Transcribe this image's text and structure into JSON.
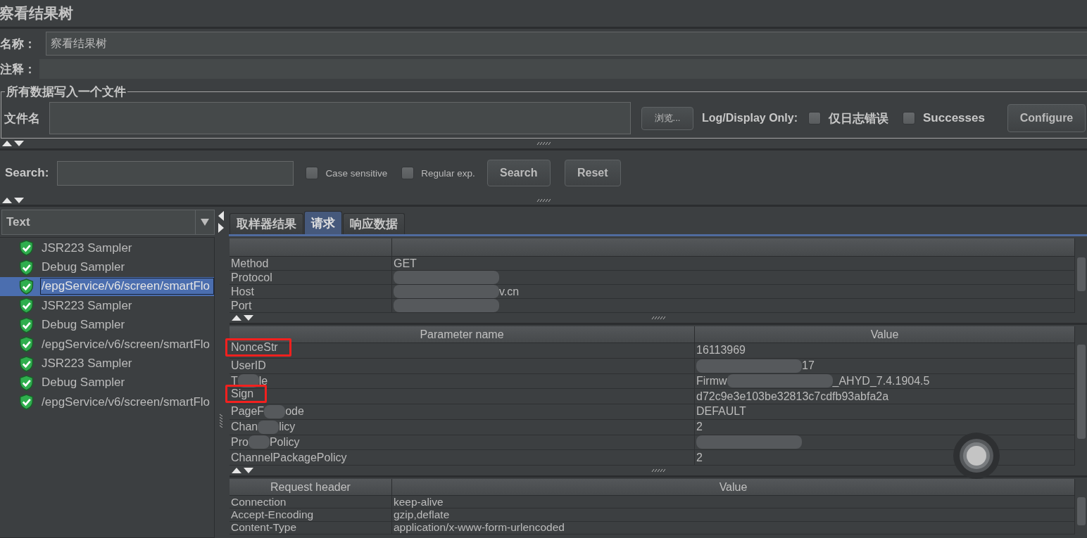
{
  "window": {
    "title": "察看结果树"
  },
  "name_field": {
    "label": "名称：",
    "value": "察看结果树"
  },
  "comment_field": {
    "label": "注释："
  },
  "file_output": {
    "title": "所有数据写入一个文件",
    "filename_label": "文件名",
    "browse_button": "浏览...",
    "log_display_label": "Log/Display Only:",
    "options": [
      {
        "label": "仅日志错误",
        "checked": false
      },
      {
        "label": "Successes",
        "checked": false
      }
    ],
    "configure_button": "Configure"
  },
  "search": {
    "label": "Search:",
    "options": [
      {
        "label": "Case sensitive",
        "checked": false
      },
      {
        "label": "Regular exp.",
        "checked": false
      }
    ],
    "search_button": "Search",
    "reset_button": "Reset"
  },
  "results_tree": {
    "renderer": "Text",
    "items": [
      {
        "label": "JSR223 Sampler",
        "passed": true,
        "selected": false
      },
      {
        "label": "Debug Sampler",
        "passed": true,
        "selected": false
      },
      {
        "label": "/epgService/v6/screen/smartFlo",
        "passed": true,
        "selected": true
      },
      {
        "label": "JSR223 Sampler",
        "passed": true,
        "selected": false
      },
      {
        "label": "Debug Sampler",
        "passed": true,
        "selected": false
      },
      {
        "label": "/epgService/v6/screen/smartFlo",
        "passed": true,
        "selected": false
      },
      {
        "label": "JSR223 Sampler",
        "passed": true,
        "selected": false
      },
      {
        "label": "Debug Sampler",
        "passed": true,
        "selected": false
      },
      {
        "label": "/epgService/v6/screen/smartFlo",
        "passed": true,
        "selected": false
      }
    ]
  },
  "tabs": [
    {
      "label": "取样器结果",
      "selected": false
    },
    {
      "label": "请求",
      "selected": true
    },
    {
      "label": "响应数据",
      "selected": false
    }
  ],
  "request_table": {
    "rows": [
      {
        "name": "Method",
        "value": "GET"
      },
      {
        "name": "Protocol",
        "value": [
          {
            "kind": "blur"
          }
        ]
      },
      {
        "name": "Host",
        "value": [
          {
            "kind": "blur"
          },
          {
            "kind": "text",
            "text": "v.cn"
          }
        ]
      },
      {
        "name": "Port",
        "value": [
          {
            "kind": "blur"
          }
        ]
      }
    ]
  },
  "parameters_table": {
    "columns": [
      "Parameter name",
      "Value"
    ],
    "rows": [
      {
        "name": "NonceStr",
        "value": "16113969",
        "highlighted": true
      },
      {
        "name": "UserID",
        "value": [
          {
            "kind": "blur"
          },
          {
            "kind": "text",
            "text": "17"
          }
        ],
        "highlighted": false
      },
      {
        "name": [
          {
            "kind": "text",
            "text": "T"
          },
          {
            "kind": "blur"
          },
          {
            "kind": "text",
            "text": "le"
          }
        ],
        "value": [
          {
            "kind": "text",
            "text": "Firmw"
          },
          {
            "kind": "blur"
          },
          {
            "kind": "text",
            "text": "_AHYD_7.4.1904.5"
          }
        ],
        "highlighted": false
      },
      {
        "name": "Sign",
        "value": "d72c9e3e103be32813c7cdfb93abfa2a",
        "highlighted": true
      },
      {
        "name": [
          {
            "kind": "text",
            "text": "PageF"
          },
          {
            "kind": "blur"
          },
          {
            "kind": "text",
            "text": "ode"
          }
        ],
        "value": "DEFAULT",
        "highlighted": false
      },
      {
        "name": [
          {
            "kind": "text",
            "text": "Chan"
          },
          {
            "kind": "blur"
          },
          {
            "kind": "text",
            "text": "licy"
          }
        ],
        "value": "2",
        "highlighted": false
      },
      {
        "name": [
          {
            "kind": "text",
            "text": "Pro"
          },
          {
            "kind": "blur"
          },
          {
            "kind": "text",
            "text": "Policy"
          }
        ],
        "value": [
          {
            "kind": "blur"
          }
        ],
        "highlighted": false
      },
      {
        "name": "ChannelPackagePolicy",
        "value": "2",
        "highlighted": false
      }
    ]
  },
  "headers_table": {
    "columns": [
      "Request header",
      "Value"
    ],
    "rows": [
      {
        "name": "Connection",
        "value": "keep-alive"
      },
      {
        "name": "Accept-Encoding",
        "value": "gzip,deflate"
      },
      {
        "name": "Content-Type",
        "value": "application/x-www-form-urlencoded"
      }
    ]
  }
}
